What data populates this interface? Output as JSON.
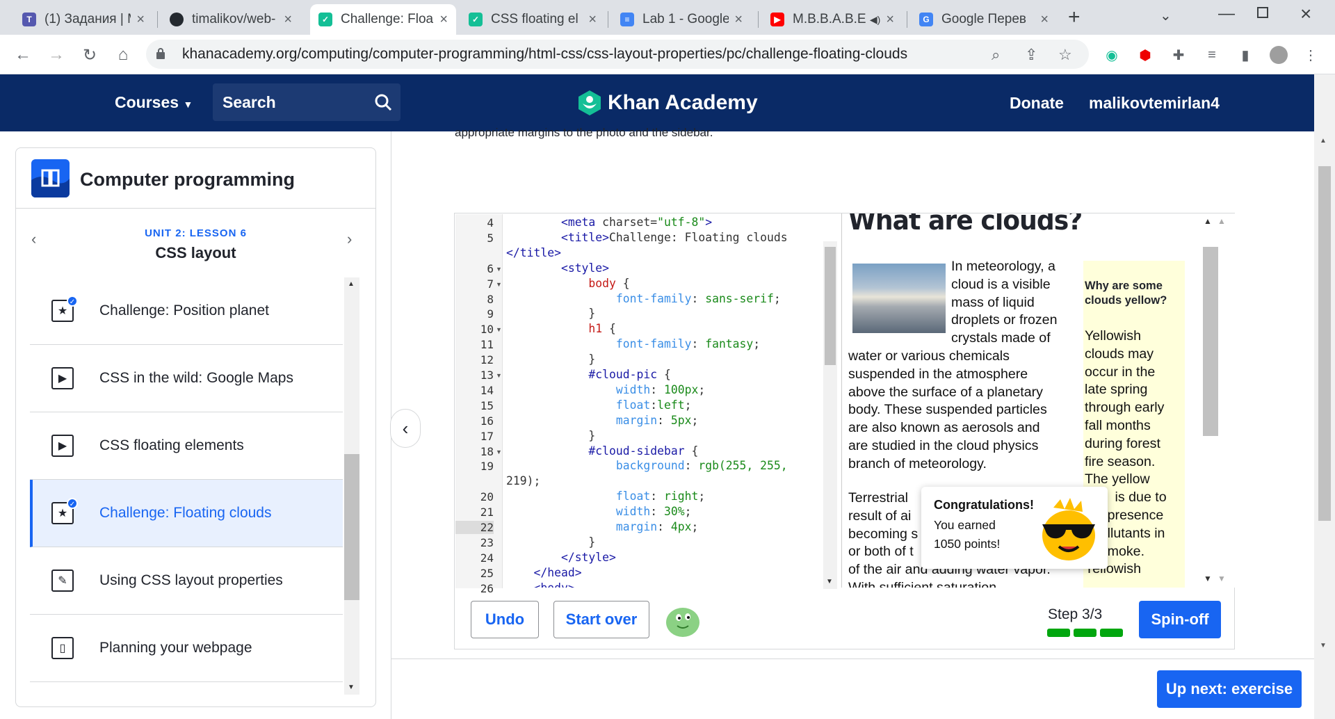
{
  "tabs": [
    {
      "title": "(1) Задания | M",
      "color": "#5558af",
      "active": false
    },
    {
      "title": "timalikov/web-",
      "color": "#24292f",
      "active": false
    },
    {
      "title": "Challenge: Floa",
      "color": "#14bf96",
      "active": true
    },
    {
      "title": "CSS floating el",
      "color": "#14bf96",
      "active": false
    },
    {
      "title": "Lab 1 - Google",
      "color": "#4285f4",
      "active": false
    },
    {
      "title": "M.B.B.A.B.E",
      "color": "#ff0000",
      "active": false
    },
    {
      "title": "Google Перев",
      "color": "#4285f4",
      "active": false
    }
  ],
  "address": {
    "url": "khanacademy.org/computing/computer-programming/html-css/css-layout-properties/pc/challenge-floating-clouds"
  },
  "header": {
    "courses": "Courses",
    "search": "Search",
    "logo": "Khan Academy",
    "donate": "Donate",
    "user": "malikovtemirlan4"
  },
  "sidebar": {
    "course": "Computer programming",
    "unit": "UNIT 2: LESSON 6",
    "lesson": "CSS layout",
    "items": [
      {
        "label": "Challenge: Position planet",
        "icon": "star-icon"
      },
      {
        "label": "CSS in the wild: Google Maps",
        "icon": "play-icon"
      },
      {
        "label": "CSS floating elements",
        "icon": "play-icon"
      },
      {
        "label": "Challenge: Floating clouds",
        "icon": "star-icon"
      },
      {
        "label": "Using CSS layout properties",
        "icon": "pencil-icon"
      },
      {
        "label": "Planning your webpage",
        "icon": "document-icon"
      }
    ]
  },
  "main": {
    "intro_cut": "appropriate margins to the photo and the sidebar."
  },
  "code": {
    "lines": [
      {
        "n": "4",
        "t": "        <meta charset=\"utf-8\">"
      },
      {
        "n": "5",
        "t": "        <title>Challenge: Floating clouds"
      },
      {
        "n": "",
        "t": "</title>"
      },
      {
        "n": "6",
        "t": "        <style>"
      },
      {
        "n": "7",
        "t": "            body {"
      },
      {
        "n": "8",
        "t": "                font-family: sans-serif;"
      },
      {
        "n": "9",
        "t": "            }"
      },
      {
        "n": "10",
        "t": "            h1 {"
      },
      {
        "n": "11",
        "t": "                font-family: fantasy;"
      },
      {
        "n": "12",
        "t": "            }"
      },
      {
        "n": "13",
        "t": "            #cloud-pic {"
      },
      {
        "n": "14",
        "t": "                width: 100px;"
      },
      {
        "n": "15",
        "t": "                float:left;"
      },
      {
        "n": "16",
        "t": "                margin: 5px;"
      },
      {
        "n": "17",
        "t": "            }"
      },
      {
        "n": "18",
        "t": "            #cloud-sidebar {"
      },
      {
        "n": "19",
        "t": "                background: rgb(255, 255,"
      },
      {
        "n": "",
        "t": "219);"
      },
      {
        "n": "20",
        "t": "                float: right;"
      },
      {
        "n": "21",
        "t": "                width: 30%;"
      },
      {
        "n": "22",
        "t": "                margin: 4px;"
      },
      {
        "n": "23",
        "t": "            }"
      },
      {
        "n": "24",
        "t": "        </style>"
      },
      {
        "n": "25",
        "t": "    </head>"
      },
      {
        "n": "26",
        "t": "    <body>"
      }
    ]
  },
  "preview": {
    "title": "What are clouds?",
    "main_text": "In meteorology, a\ncloud is a visible\nmass of liquid\ndroplets or frozen\ncrystals made of",
    "main_text2": "water or various chemicals\nsuspended in the atmosphere\nabove the surface of a planetary\nbody. These suspended particles\nare also known as aerosols and\nare studied in the cloud physics\nbranch of meteorology.",
    "main_text3": "Terrestrial\nresult of ai\nbecoming s\nor both of t\nof the air and adding water vapor.\nWith sufficient saturation,",
    "sidebar_heading": "Why are some clouds yellow?",
    "sidebar_text": "Yellowish\nclouds may\noccur in the\nlate spring\nthrough early\nfall months\nduring forest\nfire season.\nThe yellow\n        is due to\n      presence\n      llutants in\n      moke.\nYellowish"
  },
  "toast": {
    "title": "Congratulations!",
    "text": "You earned\n1050 points!"
  },
  "toolbar": {
    "undo": "Undo",
    "start_over": "Start over",
    "step": "Step 3/3",
    "spin_off": "Spin-off",
    "up_next": "Up next: exercise",
    "progress_filled": 3,
    "progress_total": 3
  },
  "colors": {
    "brand": "#1865f2",
    "header": "#0a2a66",
    "success": "#00a60e",
    "sidebar_bg": "#ffffdb"
  }
}
